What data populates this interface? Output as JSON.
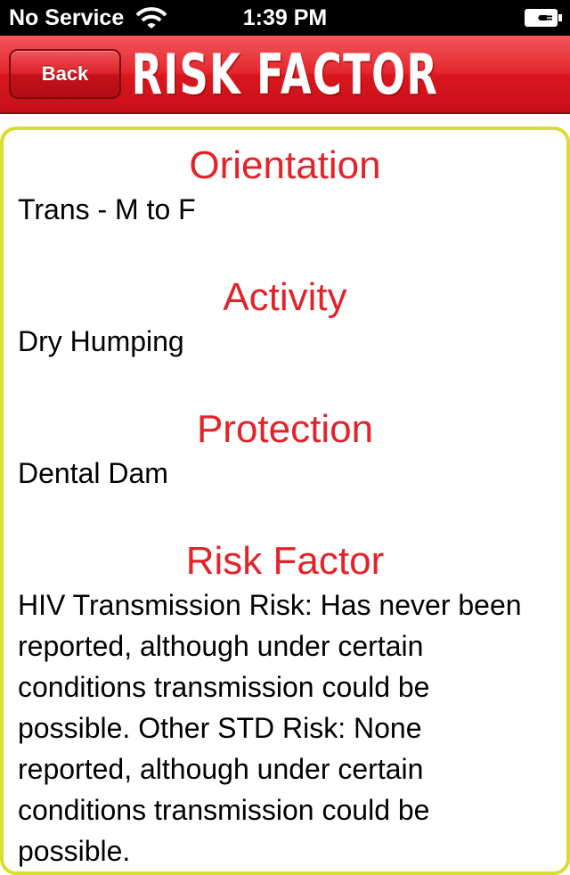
{
  "status_bar": {
    "carrier": "No Service",
    "time": "1:39 PM",
    "wifi_icon": "wifi-icon",
    "battery_icon": "battery-charging-icon"
  },
  "nav_bar": {
    "back_label": "Back",
    "title": "RISK FACTOR"
  },
  "sections": [
    {
      "heading": "Orientation",
      "body": "Trans - M to F"
    },
    {
      "heading": "Activity",
      "body": "Dry Humping"
    },
    {
      "heading": "Protection",
      "body": "Dental Dam"
    },
    {
      "heading": "Risk Factor",
      "body": "HIV Transmission Risk: Has never been reported, although under certain conditions transmission could be possible.  Other STD Risk: None reported, although under certain conditions transmission could be possible."
    }
  ],
  "colors": {
    "accent_red": "#e3232a",
    "panel_border": "#d8de2e"
  }
}
